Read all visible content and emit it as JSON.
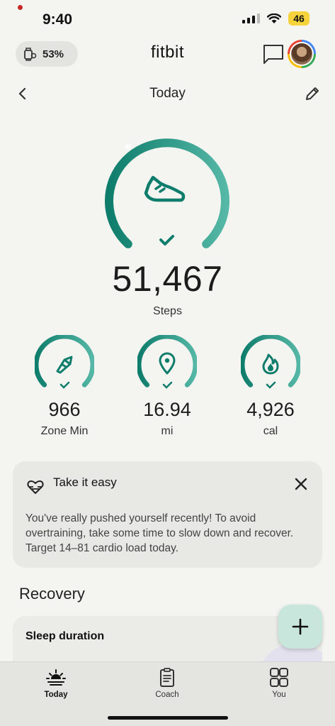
{
  "status_bar": {
    "time": "9:40",
    "battery": "46"
  },
  "header": {
    "app_title": "fitbit",
    "device_battery": "53%"
  },
  "date_nav": {
    "label": "Today"
  },
  "steps": {
    "value": "51,467",
    "label": "Steps",
    "progress": 1.0
  },
  "stats": [
    {
      "value": "966",
      "label": "Zone Min",
      "icon": "zone-minutes-icon"
    },
    {
      "value": "16.94",
      "label": "mi",
      "icon": "location-pin-icon"
    },
    {
      "value": "4,926",
      "label": "cal",
      "icon": "flame-icon"
    }
  ],
  "card": {
    "title": "Take it easy",
    "body": "You've really pushed yourself recently! To avoid overtraining, take some time to slow down and recover. Target 14–81 cardio load today."
  },
  "recovery": {
    "title": "Recovery",
    "first_item": "Sleep duration"
  },
  "bottom_nav": [
    {
      "label": "Today",
      "active": true
    },
    {
      "label": "Coach",
      "active": false
    },
    {
      "label": "You",
      "active": false
    }
  ],
  "colors": {
    "accent_dark": "#0f7d6c",
    "accent_light": "#4fb3a2",
    "background": "#f4f5f1"
  }
}
